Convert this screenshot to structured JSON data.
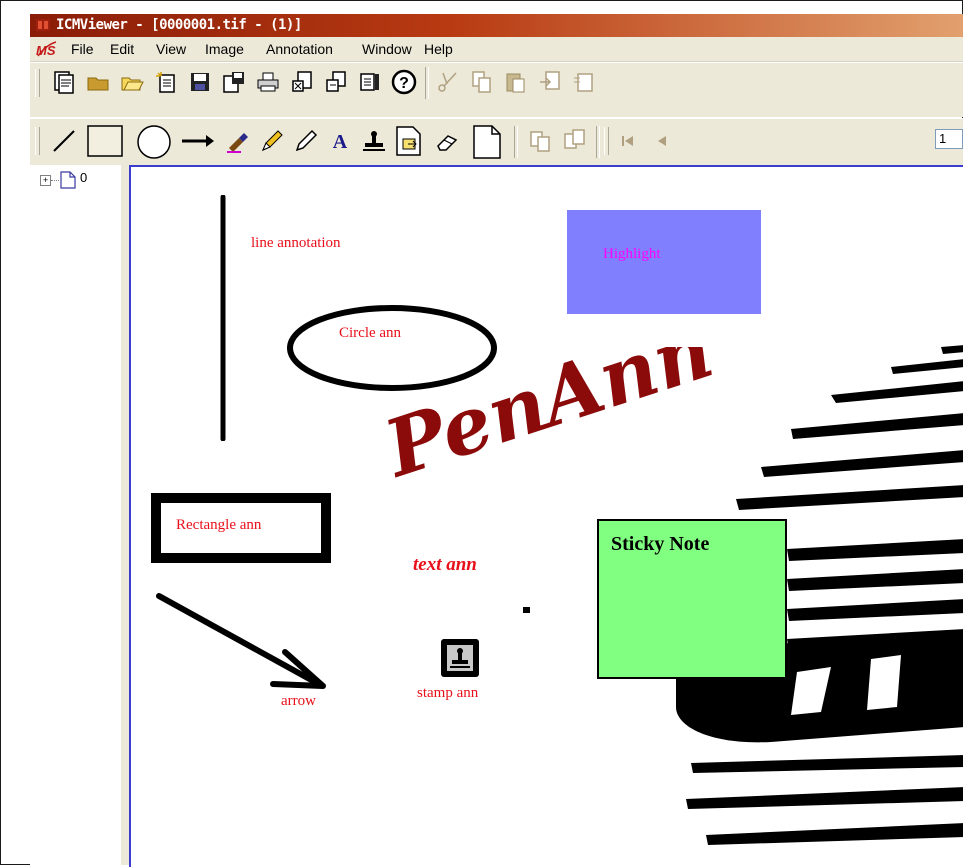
{
  "window": {
    "title": "ICMViewer - [0000001.tif - (1)]"
  },
  "menu": {
    "items": [
      "File",
      "Edit",
      "View",
      "Image",
      "Annotation",
      "Window",
      "Help"
    ]
  },
  "toolbar": {
    "page_number": "1"
  },
  "tree": {
    "node_label": "0"
  },
  "annotations": {
    "line_label": "line annotation",
    "highlight_label": "Highlight",
    "circle_label": "Circle ann",
    "pen_text": "PenAnn",
    "rectangle_label": "Rectangle ann",
    "text_label": "text ann",
    "sticky_label": "Sticky Note",
    "arrow_label": "arrow",
    "stamp_label": "stamp ann"
  },
  "colors": {
    "annotation_text": "#e8101a",
    "highlight_fill": "#8080ff",
    "sticky_fill": "#80ff80",
    "pen_ink": "#8b0a0a"
  }
}
